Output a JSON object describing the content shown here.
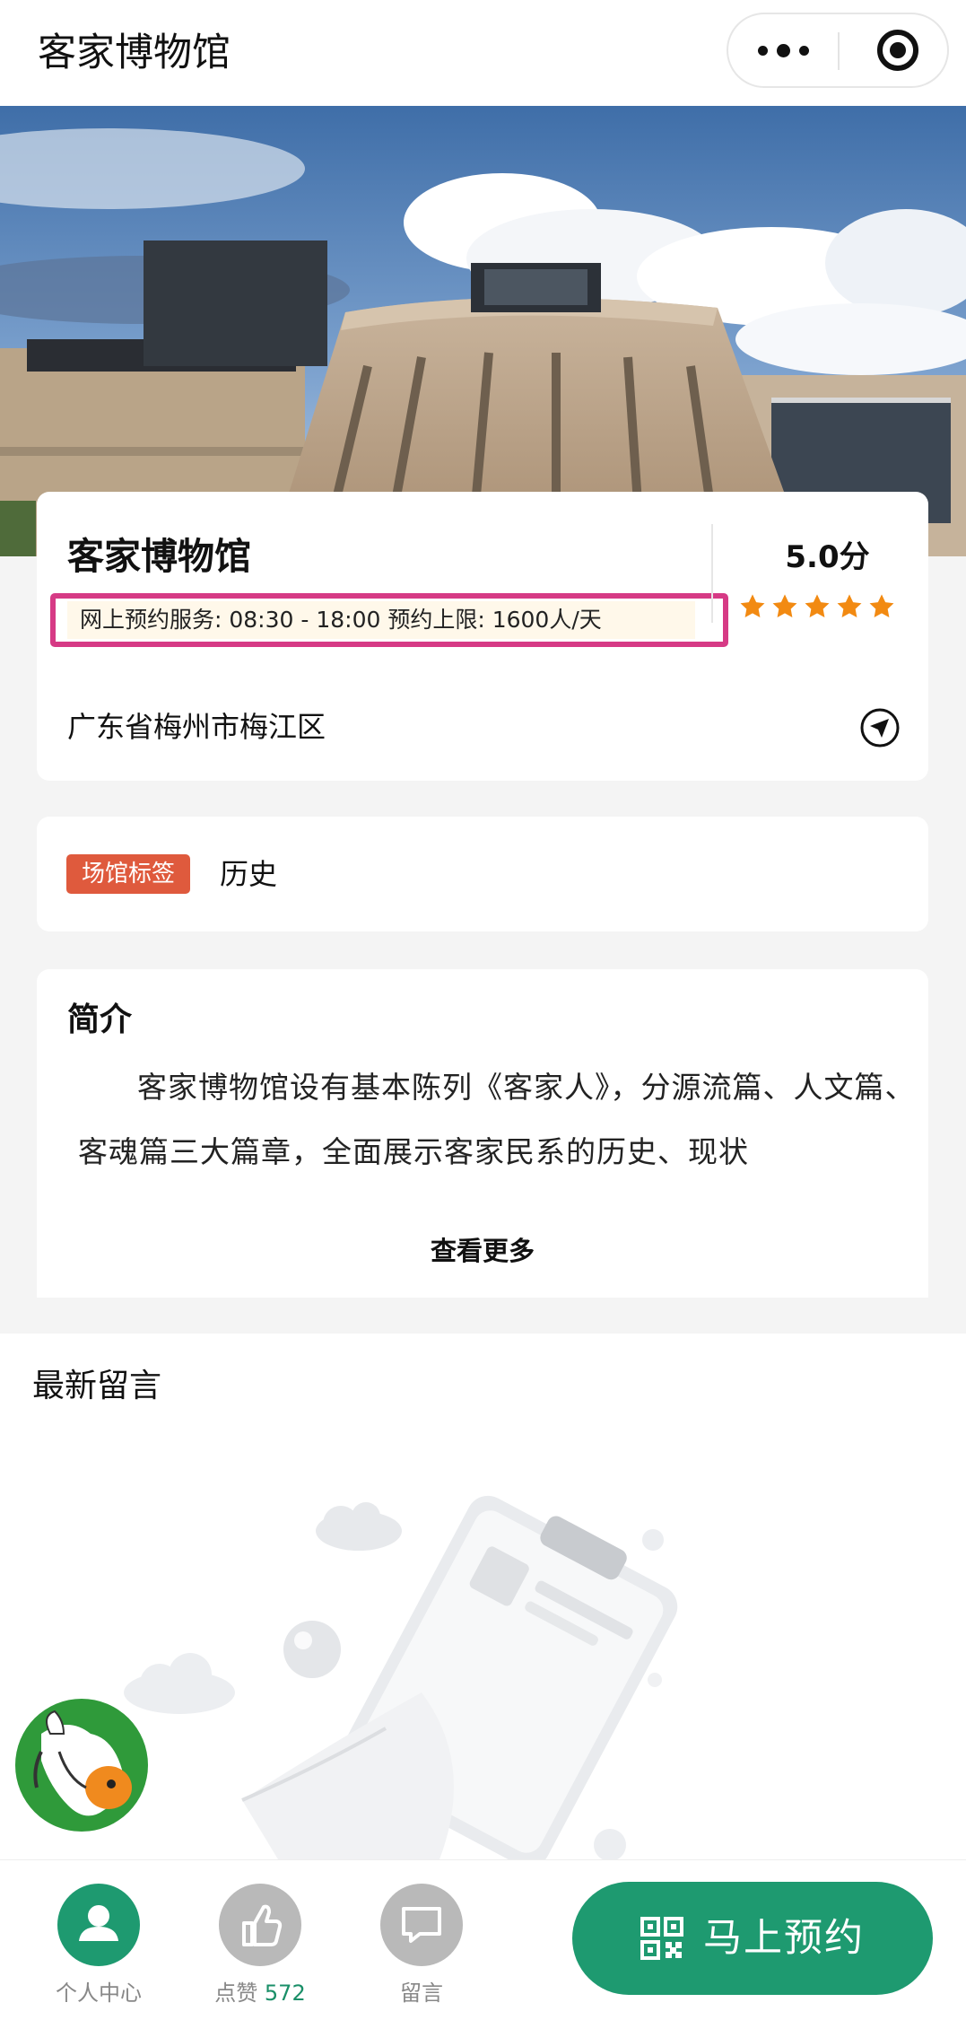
{
  "nav": {
    "title": "客家博物馆"
  },
  "venue": {
    "name": "客家博物馆",
    "hours_text": "网上预约服务: 08:30 - 18:00 预约上限:  1600人/天",
    "score": "5.0分",
    "rating": 5,
    "address": "广东省梅州市梅江区"
  },
  "tags": {
    "badge": "场馆标签",
    "value": "历史"
  },
  "intro": {
    "title": "简介",
    "text": "客家博物馆设有基本陈列《客家人》，分源流篇、人文篇、客魂篇三大篇章，全面展示客家民系的历史、现状",
    "more": "查看更多"
  },
  "comments": {
    "title": "最新留言"
  },
  "bottom": {
    "personal_label": "个人中心",
    "like_label": "点赞",
    "like_count": "572",
    "message_label": "留言",
    "reserve_label": "马上预约"
  },
  "colors": {
    "accent": "#1e9a70",
    "tag": "#df5a3d",
    "star": "#f28a12",
    "highlight_border": "#d63a85"
  },
  "icons": [
    "more-icon",
    "close-circle-icon",
    "star-icon",
    "navigation-arrow-icon",
    "person-icon",
    "thumbs-up-icon",
    "chat-bubble-icon",
    "qr-code-icon"
  ]
}
